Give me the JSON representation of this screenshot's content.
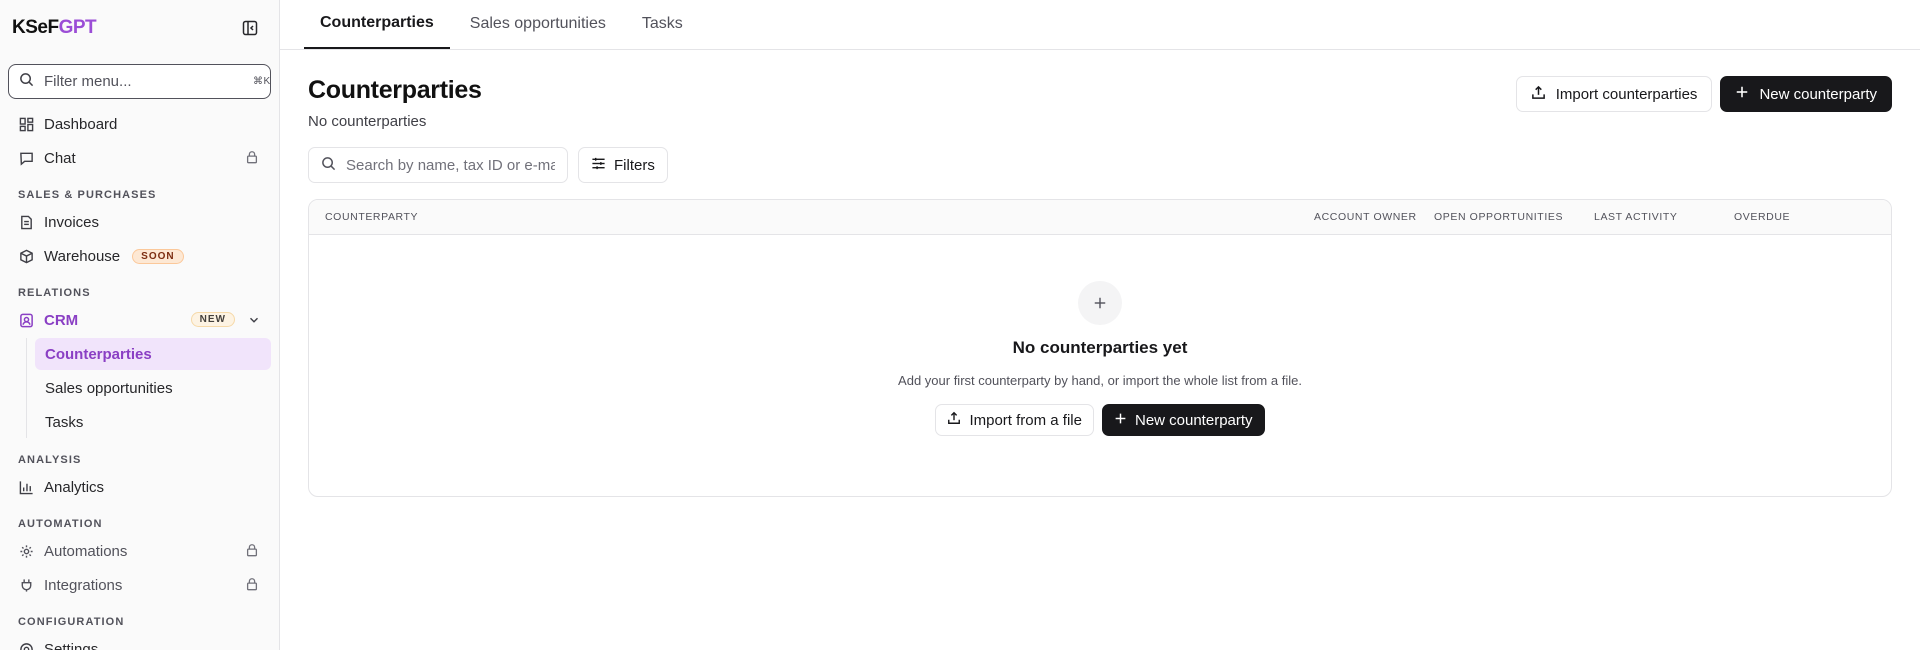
{
  "brand": {
    "part1": "KSeF",
    "part2": "GPT"
  },
  "sidebar": {
    "filter_placeholder": "Filter menu...",
    "filter_shortcut": "⌘K",
    "items": {
      "dashboard": "Dashboard",
      "chat": "Chat",
      "invoices": "Invoices",
      "warehouse": "Warehouse",
      "warehouse_badge": "SOON",
      "crm": "CRM",
      "crm_badge": "NEW",
      "analytics": "Analytics",
      "automations": "Automations",
      "integrations": "Integrations",
      "settings": "Settings"
    },
    "sections": {
      "sales": "SALES & PURCHASES",
      "relations": "RELATIONS",
      "analysis": "ANALYSIS",
      "automation": "AUTOMATION",
      "configuration": "CONFIGURATION"
    },
    "crm_sub": [
      "Counterparties",
      "Sales opportunities",
      "Tasks"
    ]
  },
  "tabs": [
    "Counterparties",
    "Sales opportunities",
    "Tasks"
  ],
  "page": {
    "title": "Counterparties",
    "subtitle": "No counterparties",
    "import_button": "Import counterparties",
    "new_button": "New counterparty"
  },
  "toolbar": {
    "search_placeholder": "Search by name, tax ID or e-mail",
    "filters_button": "Filters"
  },
  "table": {
    "columns": [
      "COUNTERPARTY",
      "ACCOUNT OWNER",
      "OPEN OPPORTUNITIES",
      "LAST ACTIVITY",
      "OVERDUE"
    ]
  },
  "empty_state": {
    "title": "No counterparties yet",
    "description": "Add your first counterparty by hand, or import the whole list from a file.",
    "import_button": "Import from a file",
    "new_button": "New counterparty"
  },
  "colors": {
    "accent": "#8a3fc4",
    "dark": "#18181b"
  }
}
